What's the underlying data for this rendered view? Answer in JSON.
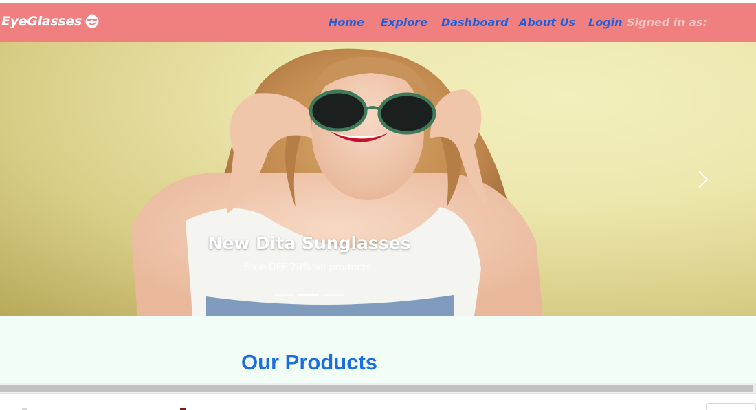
{
  "brand": {
    "name": "EyeGlasses",
    "icon": "sunglasses-face-icon"
  },
  "nav": {
    "items": [
      {
        "label": "Home"
      },
      {
        "label": "Explore"
      },
      {
        "label": "Dashboard"
      },
      {
        "label": "About Us"
      },
      {
        "label": "Login"
      }
    ],
    "signed_in_label": "Signed in as:"
  },
  "carousel": {
    "title": "New Dita Sunglasses",
    "subtitle": "Sale OFF 20% all products.",
    "slide_count": 3,
    "active_slide": 2,
    "next_icon": "chevron-right-icon"
  },
  "products": {
    "heading": "Our Products"
  },
  "colors": {
    "navbar": "#f08080",
    "nav_link": "#1a5fe0",
    "heading": "#1a6fe0",
    "section_bg": "#f3fdf8"
  }
}
